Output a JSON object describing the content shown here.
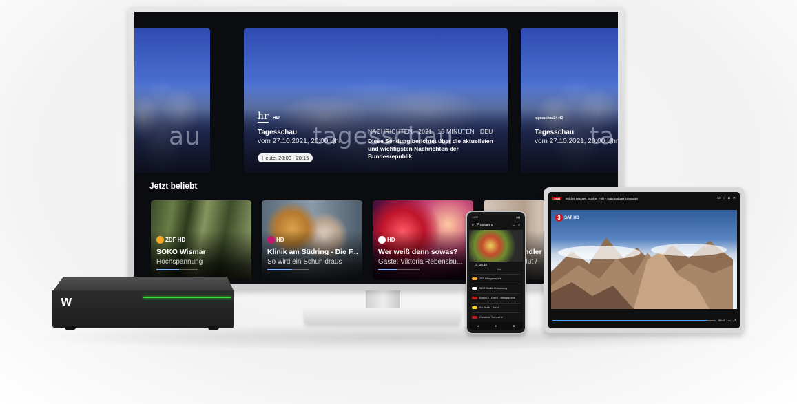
{
  "tv": {
    "hero_left": {
      "watermark": "au"
    },
    "hero_main": {
      "channel_logo": "hr",
      "channel_suffix": "HD",
      "title": "Tagesschau",
      "subtitle": "vom 27.10.2021, 20:00 Uhr",
      "watermark": "tagesschau",
      "meta": [
        "NACHRICHTEN",
        "2021",
        "15 MINUTEN",
        "DEU"
      ],
      "description": "Diese Sendung berichtet über die aktuellsten und wichtigsten Nachrichten der Bundesrepublik.",
      "time_pill": "Heute, 20:00 - 20:15"
    },
    "hero_right": {
      "channel_logo": "tagesschau24 HD",
      "title": "Tagesschau",
      "subtitle": "vom 27.10.2021, 20:00 Uhr",
      "watermark": "ta"
    },
    "section_title": "Jetzt beliebt",
    "cards": [
      {
        "logo": "ZDF HD",
        "title": "SOKO Wismar",
        "subtitle": "Hochspannung",
        "progress": 0.55,
        "logo_color": "#f6a623"
      },
      {
        "logo": "HD",
        "title": "Klinik am Südring - Die F...",
        "subtitle": "So wird ein Schuh draus",
        "progress": 0.6,
        "logo_color": "#c4166d"
      },
      {
        "logo": "HD",
        "title": "Wer weiß denn sowas?",
        "subtitle": "Gäste: Viktoria Rebensbu...",
        "progress": 0.45,
        "logo_color": "#ffffff"
      },
      {
        "logo": "",
        "title": "indler",
        "subtitle": "plut /",
        "progress": 0.3,
        "logo_color": "#ffffff"
      }
    ]
  },
  "box": {
    "logo": "W"
  },
  "phone": {
    "status_time": "14:33",
    "header_title": "Programm",
    "date": "Di. 26.10",
    "live_label": "Jetzt",
    "rows": [
      {
        "channel_color": "#f6a623",
        "program": "ZDF-Mittagsmagazin"
      },
      {
        "channel_color": "#ffffff",
        "program": "WDR Studio, Entwicklung"
      },
      {
        "channel_color": "#c4161c",
        "program": "Rosin 12 - Die RTL Mittagsjournal"
      },
      {
        "channel_color": "#ffd400",
        "program": "Sat Studio - Berlin"
      },
      {
        "channel_color": "#c4161c",
        "program": "Gemeinde Tod und Te"
      }
    ],
    "nav": [
      "◂",
      "●",
      "■"
    ]
  },
  "tablet": {
    "channel_logo": "3sat",
    "title": "Wildes Wasser, Starker Fels - Nationalpark Gesäuse",
    "channel_badge_number": "3",
    "channel_badge_label": "SAT HD",
    "progress": 0.95,
    "time_label": "00:47"
  },
  "colors": {
    "accent_progress": "#8ab4ff",
    "box_led": "#35e03a"
  }
}
